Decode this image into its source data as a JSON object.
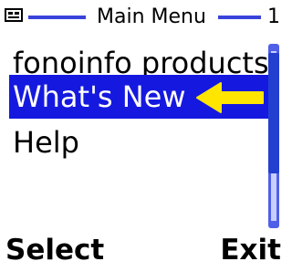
{
  "header": {
    "icon": "device-icon",
    "title": "Main Menu",
    "page_number": "1"
  },
  "menu": {
    "items": [
      {
        "label": "fonoinfo products",
        "selected": false
      },
      {
        "label": "What's New",
        "selected": true,
        "pointer_icon": "yellow-arrow-icon"
      },
      {
        "label": "Help",
        "selected": false
      }
    ]
  },
  "scrollbar": {
    "visible": true
  },
  "softkeys": {
    "left": "Select",
    "right": "Exit"
  },
  "colors": {
    "selection_blue": "#1519df",
    "line_blue": "#3a43d9",
    "arrow_yellow": "#ffe500",
    "text": "#000000",
    "background": "#ffffff"
  }
}
